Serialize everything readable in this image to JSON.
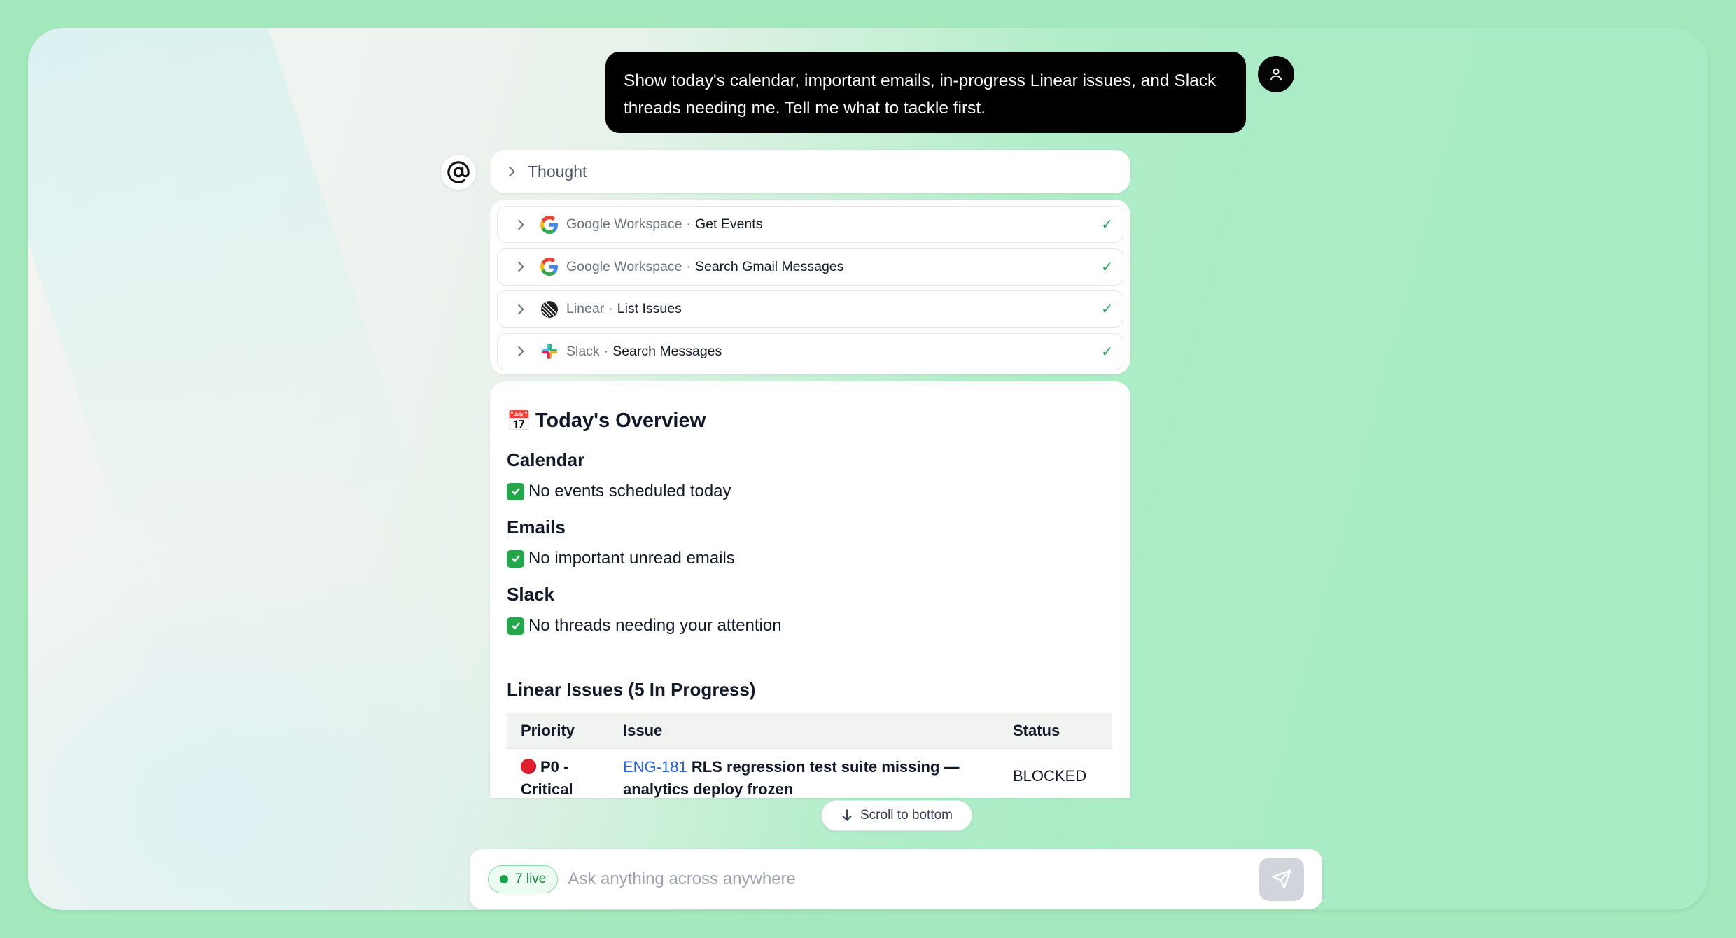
{
  "conversation": {
    "user_message": "Show today's calendar, important emails, in-progress Linear issues, and Slack threads needing me. Tell me what to tackle first.",
    "thought_label": "Thought",
    "tool_calls": [
      {
        "provider": "Google Workspace",
        "separator": "·",
        "action": "Get Events",
        "icon": "google-icon",
        "status": "✓"
      },
      {
        "provider": "Google Workspace",
        "separator": "·",
        "action": "Search Gmail Messages",
        "icon": "google-icon",
        "status": "✓"
      },
      {
        "provider": "Linear",
        "separator": "·",
        "action": "List Issues",
        "icon": "linear-icon",
        "status": "✓"
      },
      {
        "provider": "Slack",
        "separator": "·",
        "action": "Search Messages",
        "icon": "slack-icon",
        "status": "✓"
      }
    ]
  },
  "answer": {
    "title": "Today's Overview",
    "title_icon": "📅",
    "sections": [
      {
        "heading": "Calendar",
        "text": "No events scheduled today"
      },
      {
        "heading": "Emails",
        "text": "No important unread emails"
      },
      {
        "heading": "Slack",
        "text": "No threads needing your attention"
      }
    ],
    "linear_heading": "Linear Issues (5 In Progress)",
    "table": {
      "headers": [
        "Priority",
        "Issue",
        "Status"
      ],
      "rows": [
        {
          "priority": "P0 - Critical",
          "issue_id": "ENG-181",
          "issue_title": "RLS regression test suite missing — analytics deploy frozen",
          "status": "BLOCKED"
        }
      ]
    }
  },
  "scroll_button_label": "Scroll to bottom",
  "composer": {
    "live_label": "7 live",
    "placeholder": "Ask anything across anywhere"
  },
  "colors": {
    "background": "#a4e9bd",
    "user_bubble": "#000000",
    "check_green": "#16a34a",
    "link_blue": "#2563eb",
    "priority_red": "#e11d2e"
  }
}
